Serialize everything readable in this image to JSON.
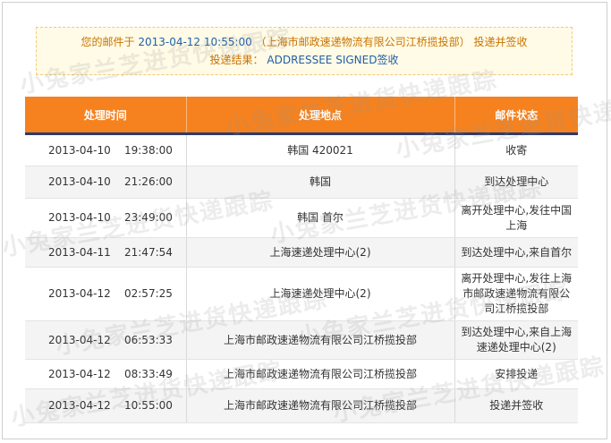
{
  "notice": {
    "prefix": "您的邮件于",
    "datetime": "2013-04-12 10:55:00",
    "office": "上海市邮政速递物流有限公司江桥揽投部",
    "result_text": "投递并签收",
    "result_label": "投递结果：",
    "result_value": "ADDRESSEE SIGNED签收"
  },
  "table": {
    "headers": [
      "处理时间",
      "处理地点",
      "邮件状态"
    ],
    "rows": [
      {
        "time": "2013-04-10    19:38:00",
        "location": "韩国 420021",
        "status": "收寄"
      },
      {
        "time": "2013-04-10    21:26:00",
        "location": "韩国",
        "status": "到达处理中心"
      },
      {
        "time": "2013-04-10    23:49:00",
        "location": "韩国 首尔",
        "status": "离开处理中心,发往中国上海"
      },
      {
        "time": "2013-04-11    21:47:54",
        "location": "上海速递处理中心(2)",
        "status": "到达处理中心,来自首尔"
      },
      {
        "time": "2013-04-12    02:57:25",
        "location": "上海速递处理中心(2)",
        "status": "离开处理中心,发往上海市邮政速递物流有限公司江桥揽投部"
      },
      {
        "time": "2013-04-12    06:53:33",
        "location": "上海市邮政速递物流有限公司江桥揽投部",
        "status": "到达处理中心,来自上海速递处理中心(2)"
      },
      {
        "time": "2013-04-12    08:33:49",
        "location": "上海市邮政速递物流有限公司江桥揽投部",
        "status": "安排投递"
      },
      {
        "time": "2013-04-12    10:55:00",
        "location": "上海市邮政速递物流有限公司江桥揽投部",
        "status": "投递并签收"
      }
    ]
  },
  "watermark": "小兔家兰芝进货快递跟踪"
}
